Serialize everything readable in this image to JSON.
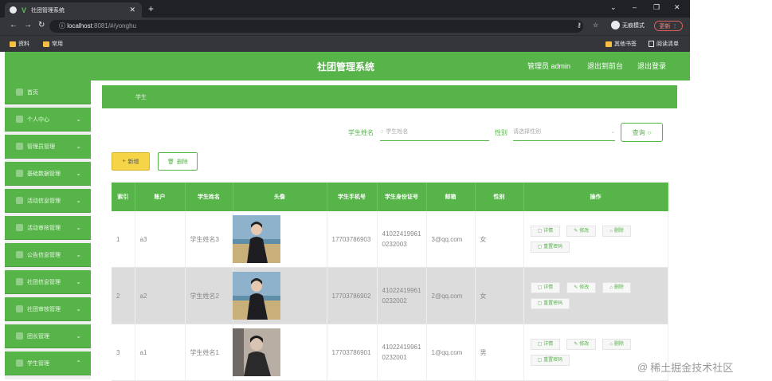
{
  "browser": {
    "tab_title": "社团管理系统",
    "tab_logo": "V",
    "url_host": "localhost",
    "url_rest": ":8081/#/yonghu",
    "incognito_label": "无痕模式",
    "update_label": "更新",
    "bookmarks": [
      "资料",
      "常用"
    ],
    "bookmarks_right": [
      "其他书签",
      "阅读清单"
    ]
  },
  "header": {
    "title": "社团管理系统",
    "admin_label": "管理员 admin",
    "frontend_link": "退出到前台",
    "logout_link": "退出登录"
  },
  "sidebar": {
    "items": [
      {
        "label": "首页",
        "chevron": ""
      },
      {
        "label": "个人中心",
        "chevron": "⌄"
      },
      {
        "label": "管理员管理",
        "chevron": "⌄"
      },
      {
        "label": "基础数据管理",
        "chevron": "⌄"
      },
      {
        "label": "活动信息管理",
        "chevron": "⌄"
      },
      {
        "label": "活动审核管理",
        "chevron": "⌄"
      },
      {
        "label": "公告信息管理",
        "chevron": "⌄"
      },
      {
        "label": "社团信息管理",
        "chevron": "⌄"
      },
      {
        "label": "社团审核管理",
        "chevron": "⌄"
      },
      {
        "label": "团长管理",
        "chevron": "⌄"
      },
      {
        "label": "学生管理",
        "chevron": "⌃"
      }
    ]
  },
  "breadcrumb": "学生",
  "search": {
    "name_label": "学生姓名",
    "name_placeholder": "学生姓名",
    "gender_label": "性别",
    "gender_placeholder": "请选择性别",
    "query_button": "查询"
  },
  "actions": {
    "add_label": "新增",
    "delete_label": "删除"
  },
  "table": {
    "headers": [
      "索引",
      "账户",
      "学生姓名",
      "头像",
      "学生手机号",
      "学生身份证号",
      "邮箱",
      "性别",
      "操作"
    ],
    "rows": [
      {
        "index": "1",
        "account": "a3",
        "name": "学生姓名3",
        "phone": "17703786903",
        "id_card": "410224199610232003",
        "email": "3@qq.com",
        "gender": "女",
        "avatar": "photo-outdoor-1"
      },
      {
        "index": "2",
        "account": "a2",
        "name": "学生姓名2",
        "phone": "17703786902",
        "id_card": "410224199610232002",
        "email": "2@qq.com",
        "gender": "女",
        "avatar": "photo-outdoor-2"
      },
      {
        "index": "3",
        "account": "a1",
        "name": "学生姓名1",
        "phone": "17703786901",
        "id_card": "410224199610232001",
        "email": "1@qq.com",
        "gender": "男",
        "avatar": "photo-indoor"
      }
    ],
    "ops": {
      "detail": "详情",
      "edit": "修改",
      "delete": "删除",
      "reset": "重置密码"
    }
  },
  "watermark": "稀土掘金技术社区",
  "colors": {
    "primary": "#56b449",
    "accent_yellow": "#f5d547"
  }
}
